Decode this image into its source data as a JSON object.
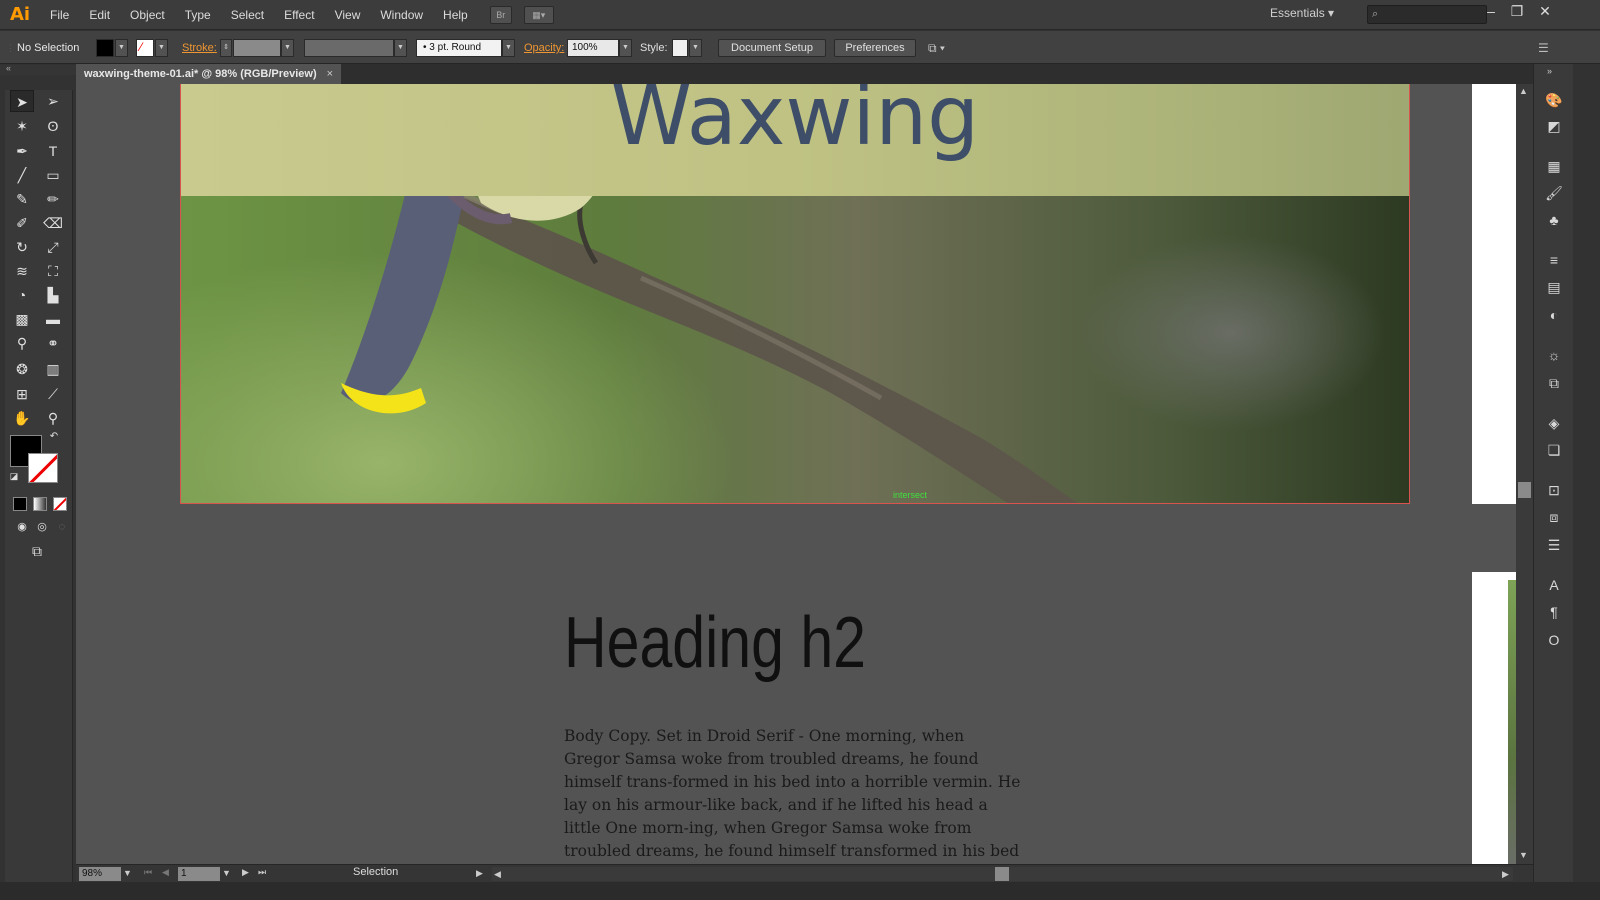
{
  "app": {
    "logo": "Ai",
    "menu": [
      "File",
      "Edit",
      "Object",
      "Type",
      "Select",
      "Effect",
      "View",
      "Window",
      "Help"
    ],
    "bridge_button": "Br",
    "workspace": "Essentials",
    "search_placeholder": ""
  },
  "control_bar": {
    "selection_state": "No Selection",
    "stroke_label": "Stroke:",
    "brush_label": "3 pt. Round",
    "opacity_label": "Opacity:",
    "opacity_value": "100%",
    "style_label": "Style:",
    "document_setup": "Document Setup",
    "preferences": "Preferences"
  },
  "document": {
    "tab_title": "waxwing-theme-01.ai* @ 98% (RGB/Preview)",
    "close_glyph": "×"
  },
  "artwork": {
    "hero_title": "Waxwing",
    "smart_guide": "intersect",
    "heading": "Heading h2",
    "body_copy": "Body Copy. Set in Droid Serif - One morning, when Gregor Samsa woke from troubled dreams, he found himself trans-formed in his bed into a horrible vermin. He lay on his armour-like back, and if he lifted his head a little One morn-ing, when Gregor Samsa woke from troubled dreams, he found himself transformed in his bed into a horrible vermin."
  },
  "status": {
    "zoom": "98%",
    "page": "1",
    "tool": "Selection"
  },
  "colors": {
    "accent_orange": "#ff9a00",
    "title_blue": "#3e4e68",
    "artboard_border": "#d9534f"
  }
}
